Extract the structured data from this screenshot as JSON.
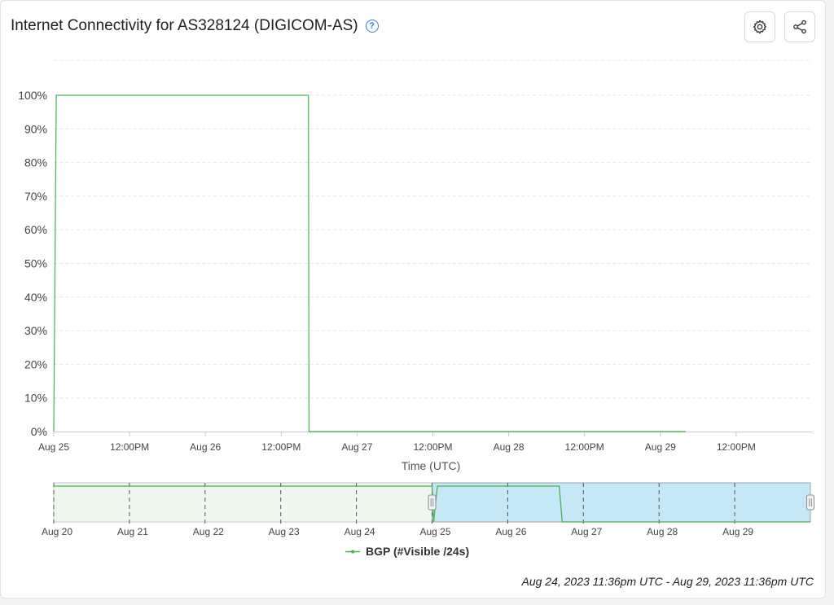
{
  "header": {
    "title": "Internet Connectivity for AS328124 (DIGICOM-AS)",
    "help_glyph": "?",
    "icons": [
      "gear-icon",
      "share-icon"
    ]
  },
  "chart_data": {
    "type": "line",
    "xlabel": "Time (UTC)",
    "ylabel": "",
    "ylim": [
      0,
      100
    ],
    "y_ticks": [
      "0%",
      "10%",
      "20%",
      "30%",
      "40%",
      "50%",
      "60%",
      "70%",
      "80%",
      "90%",
      "100%"
    ],
    "x_ticks": [
      "Aug 25",
      "12:00PM",
      "Aug 26",
      "12:00PM",
      "Aug 27",
      "12:00PM",
      "Aug 28",
      "12:00PM",
      "Aug 29",
      "12:00PM"
    ],
    "x_range_hours": [
      0,
      120
    ],
    "grid": true,
    "line_color": "#4caf50",
    "series": [
      {
        "name": "BGP (#Visible /24s)",
        "points": [
          [
            0,
            0
          ],
          [
            0.4,
            100
          ],
          [
            40.3,
            100
          ],
          [
            40.4,
            0
          ],
          [
            100,
            0
          ]
        ]
      }
    ]
  },
  "navigator": {
    "ticks": [
      "Aug 20",
      "Aug 21",
      "Aug 22",
      "Aug 23",
      "Aug 24",
      "Aug 25",
      "Aug 26",
      "Aug 27",
      "Aug 28",
      "Aug 29"
    ],
    "range_days": [
      0,
      10
    ],
    "selection_days": [
      5,
      10
    ],
    "series_points": [
      [
        0,
        100
      ],
      [
        5.0,
        100
      ],
      [
        5.02,
        0
      ],
      [
        5.07,
        100
      ],
      [
        6.68,
        100
      ],
      [
        6.72,
        0
      ],
      [
        10,
        0
      ]
    ],
    "shade_color": "#c5e8f7",
    "base_fill": "#eef8ee"
  },
  "legend": {
    "label": "BGP (#Visible /24s)",
    "color": "#4caf50"
  },
  "time_range": "Aug 24, 2023 11:36pm UTC - Aug 29, 2023 11:36pm UTC"
}
